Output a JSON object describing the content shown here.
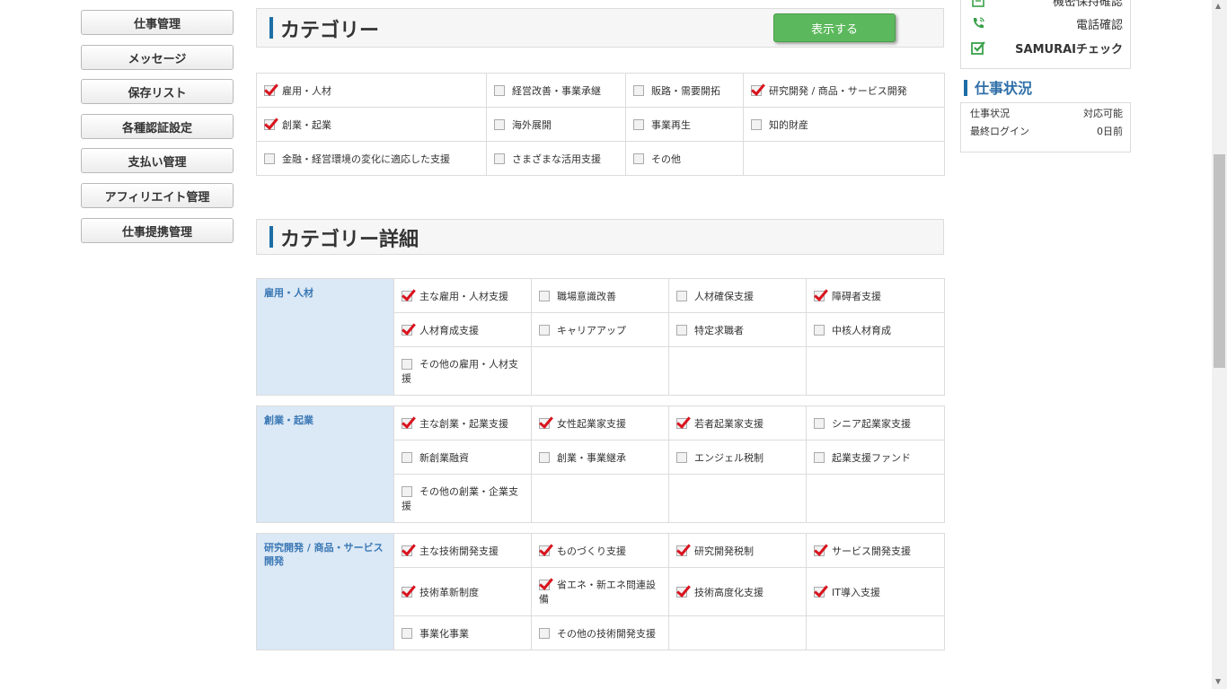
{
  "sidebar": {
    "items": [
      {
        "label": ""
      },
      {
        "label": "仕事管理"
      },
      {
        "label": "メッセージ"
      },
      {
        "label": "保存リスト"
      },
      {
        "label": "各種認証設定"
      },
      {
        "label": "支払い管理"
      },
      {
        "label": "アフィリエイト管理"
      },
      {
        "label": "仕事提携管理"
      }
    ]
  },
  "category": {
    "title": "カテゴリー",
    "show_button": "表示する",
    "rows": [
      [
        {
          "label": "雇用・人材",
          "checked": true
        },
        {
          "label": "経営改善・事業承継",
          "checked": false
        },
        {
          "label": "販路・需要開拓",
          "checked": false
        },
        {
          "label": "研究開発 / 商品・サービス開発",
          "checked": true
        }
      ],
      [
        {
          "label": "創業・起業",
          "checked": true
        },
        {
          "label": "海外展開",
          "checked": false
        },
        {
          "label": "事業再生",
          "checked": false
        },
        {
          "label": "知的財産",
          "checked": false
        }
      ],
      [
        {
          "label": "金融・経営環境の変化に適応した支援",
          "checked": false
        },
        {
          "label": "さまざまな活用支援",
          "checked": false
        },
        {
          "label": "その他",
          "checked": false
        },
        null
      ]
    ]
  },
  "category_detail": {
    "title": "カテゴリー詳細",
    "groups": [
      {
        "name": "雇用・人材",
        "rows": [
          [
            {
              "label": "主な雇用・人材支援",
              "checked": true
            },
            {
              "label": "職場意識改善",
              "checked": false
            },
            {
              "label": "人材確保支援",
              "checked": false
            },
            {
              "label": "障碍者支援",
              "checked": true
            }
          ],
          [
            {
              "label": "人材育成支援",
              "checked": true
            },
            {
              "label": "キャリアアップ",
              "checked": false
            },
            {
              "label": "特定求職者",
              "checked": false
            },
            {
              "label": "中核人材育成",
              "checked": false
            }
          ],
          [
            {
              "label": "その他の雇用・人材支援",
              "checked": false,
              "wrap": true
            },
            null,
            null,
            null
          ]
        ]
      },
      {
        "name": "創業・起業",
        "rows": [
          [
            {
              "label": "主な創業・起業支援",
              "checked": true
            },
            {
              "label": "女性起業家支援",
              "checked": true
            },
            {
              "label": "若者起業家支援",
              "checked": true
            },
            {
              "label": "シニア起業家支援",
              "checked": false
            }
          ],
          [
            {
              "label": "新創業融資",
              "checked": false
            },
            {
              "label": "創業・事業継承",
              "checked": false
            },
            {
              "label": "エンジェル税制",
              "checked": false
            },
            {
              "label": "起業支援ファンド",
              "checked": false
            }
          ],
          [
            {
              "label": "その他の創業・企業支援",
              "checked": false,
              "wrap": true
            },
            null,
            null,
            null
          ]
        ]
      },
      {
        "name": "研究開発 / 商品・サービス開発",
        "rows": [
          [
            {
              "label": "主な技術開発支援",
              "checked": true
            },
            {
              "label": "ものづくり支援",
              "checked": true
            },
            {
              "label": "研究開発税制",
              "checked": true
            },
            {
              "label": "サービス開発支援",
              "checked": true
            }
          ],
          [
            {
              "label": "技術革新制度",
              "checked": true
            },
            {
              "label": "省エネ・新エネ問連設備",
              "checked": true,
              "wrap": true
            },
            {
              "label": "技術高度化支援",
              "checked": true
            },
            {
              "label": "IT導入支援",
              "checked": true
            }
          ],
          [
            {
              "label": "事業化事業",
              "checked": false
            },
            {
              "label": "その他の技術開発支援",
              "checked": false
            },
            null,
            null
          ]
        ]
      }
    ]
  },
  "verification": {
    "items": [
      {
        "label": "機密保持確認",
        "icon": "document-icon"
      },
      {
        "label": "電話確認",
        "icon": "phone-icon"
      },
      {
        "label": "SAMURAIチェック",
        "icon": "check-square-icon"
      }
    ]
  },
  "job_status": {
    "title": "仕事状況",
    "rows": [
      {
        "label": "仕事状況",
        "value": "対応可能"
      },
      {
        "label": "最終ログイン",
        "value": "0日前"
      }
    ]
  },
  "colors": {
    "accent": "#1e6ea6",
    "check": "#d9141f",
    "button_green": "#5cb85c",
    "group_bg": "#dbe8f5"
  }
}
